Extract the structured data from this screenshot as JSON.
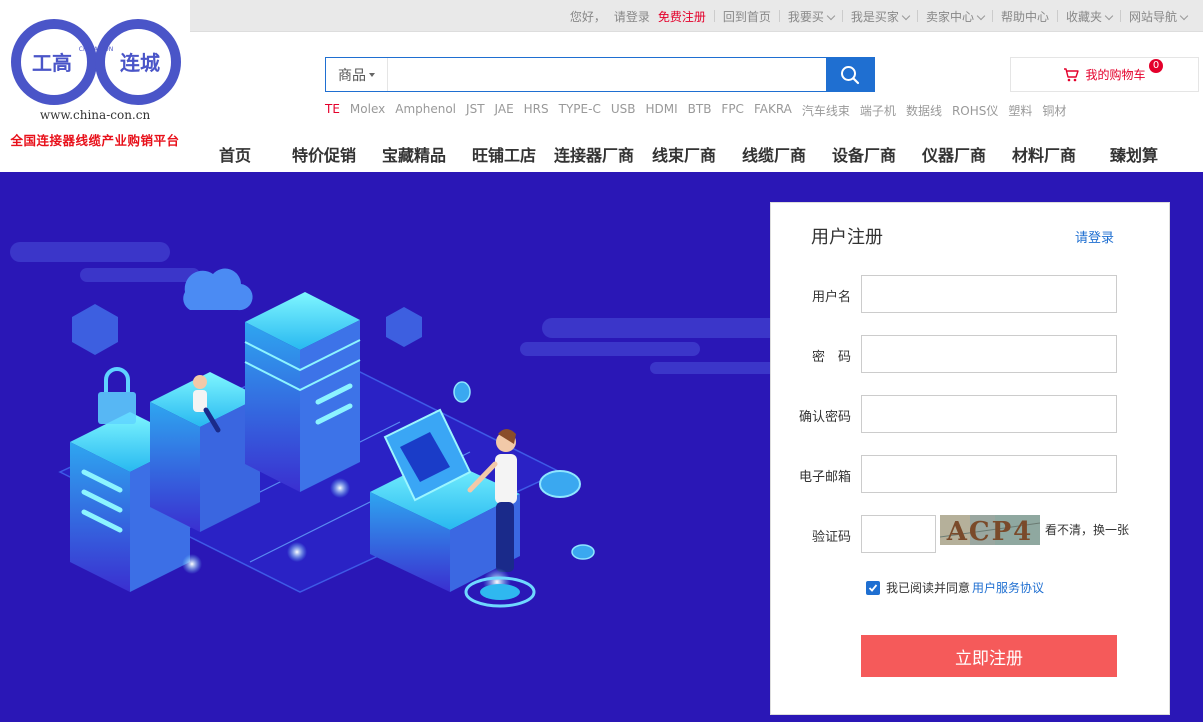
{
  "logo": {
    "left_text": "工高",
    "right_text": "连城",
    "mini_text": "CHINA-CON",
    "url": "www.china-con.cn",
    "slogan": "全国连接器线缆产业购销平台"
  },
  "topbar": {
    "greeting": "您好，",
    "login": "请登录",
    "register": "免费注册",
    "home": "回到首页",
    "buy": "我要买",
    "buyer": "我是买家",
    "seller": "卖家中心",
    "help": "帮助中心",
    "favorites": "收藏夹",
    "sitemap": "网站导航"
  },
  "search": {
    "category": "商品",
    "placeholder": "",
    "hotwords": [
      "TE",
      "Molex",
      "Amphenol",
      "JST",
      "JAE",
      "HRS",
      "TYPE-C",
      "USB",
      "HDMI",
      "BTB",
      "FPC",
      "FAKRA",
      "汽车线束",
      "端子机",
      "数据线",
      "ROHS仪",
      "塑料",
      "铜材"
    ]
  },
  "cart": {
    "label": "我的购物车",
    "count": "0"
  },
  "nav": {
    "items": [
      "首页",
      "特价促销",
      "宝藏精品",
      "旺铺工店",
      "连接器厂商",
      "线束厂商",
      "线缆厂商",
      "设备厂商",
      "仪器厂商",
      "材料厂商",
      "臻划算"
    ]
  },
  "register": {
    "title": "用户注册",
    "login_link": "请登录",
    "username_label": "用户名",
    "password_label": "密　码",
    "confirm_label": "确认密码",
    "email_label": "电子邮箱",
    "captcha_label": "验证码",
    "captcha_text": "ACP4",
    "captcha_change": "看不清，换一张",
    "agree_text": "我已阅读并同意",
    "agreement_link": "用户服务协议",
    "submit": "立即注册"
  },
  "colors": {
    "brand_blue": "#1f6fd1",
    "banner_bg": "#2a17b6",
    "accent_red": "#e4002b",
    "submit_red": "#f55a5a",
    "logo_blue": "#4a55c8"
  }
}
